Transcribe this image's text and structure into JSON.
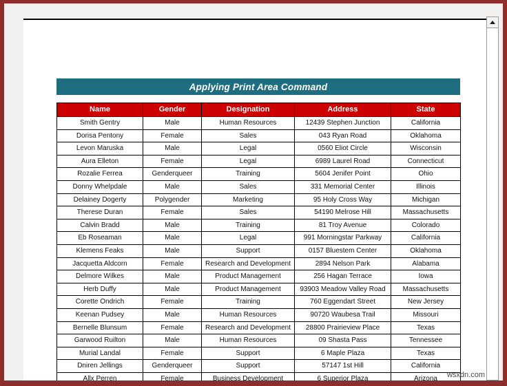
{
  "window": {
    "frame_color": "#8f2c2c",
    "workspace_color": "#f1f0ef",
    "page_color": "#ffffff"
  },
  "banner": {
    "title": "Applying Print Area Command",
    "background": "#1f6e80",
    "text_color": "#ffffff"
  },
  "table": {
    "header_background": "#cc0000",
    "header_text_color": "#ffffff",
    "columns": [
      "Name",
      "Gender",
      "Designation",
      "Address",
      "State"
    ],
    "rows": [
      [
        "Smith Gentry",
        "Male",
        "Human Resources",
        "12439 Stephen Junction",
        "California"
      ],
      [
        "Dorisa Pentony",
        "Female",
        "Sales",
        "043 Ryan Road",
        "Oklahoma"
      ],
      [
        "Levon Maruska",
        "Male",
        "Legal",
        "0560 Eliot Circle",
        "Wisconsin"
      ],
      [
        "Aura Elleton",
        "Female",
        "Legal",
        "6989 Laurel Road",
        "Connecticut"
      ],
      [
        "Rozalie Ferrea",
        "Genderqueer",
        "Training",
        "5604 Jenifer Point",
        "Ohio"
      ],
      [
        "Donny Whelpdale",
        "Male",
        "Sales",
        "331 Memorial Center",
        "Illinois"
      ],
      [
        "Delainey Dogerty",
        "Polygender",
        "Marketing",
        "95 Holy Cross Way",
        "Michigan"
      ],
      [
        "Therese Duran",
        "Female",
        "Sales",
        "54190 Melrose Hill",
        "Massachusetts"
      ],
      [
        "Calvin Bradd",
        "Male",
        "Training",
        "81 Troy Avenue",
        "Colorado"
      ],
      [
        "Eb Roseaman",
        "Male",
        "Legal",
        "991 Morningstar Parkway",
        "California"
      ],
      [
        "Klemens Feaks",
        "Male",
        "Support",
        "0157 Bluestem Center",
        "Oklahoma"
      ],
      [
        "Jacquetta Aldcorn",
        "Female",
        "Research and Development",
        "2894 Nelson Park",
        "Alabama"
      ],
      [
        "Delmore Wilkes",
        "Male",
        "Product Management",
        "256 Hagan Terrace",
        "Iowa"
      ],
      [
        "Herb Duffy",
        "Male",
        "Product Management",
        "93903 Meadow Valley Road",
        "Massachusetts"
      ],
      [
        "Corette Ondrich",
        "Female",
        "Training",
        "760 Eggendart Street",
        "New Jersey"
      ],
      [
        "Keenan Pudsey",
        "Male",
        "Human Resources",
        "90720 Waubesa Trail",
        "Missouri"
      ],
      [
        "Bernelle Blunsum",
        "Female",
        "Research and Development",
        "28800 Prairieview Place",
        "Texas"
      ],
      [
        "Garwood Ruilton",
        "Male",
        "Human Resources",
        "09 Shasta Pass",
        "Tennessee"
      ],
      [
        "Murial Landal",
        "Female",
        "Support",
        "6 Maple Plaza",
        "Texas"
      ],
      [
        "Dniren Jellings",
        "Genderqueer",
        "Support",
        "57147 1st Hill",
        "California"
      ],
      [
        "Allx Perren",
        "Female",
        "Business Development",
        "6 Superior Plaza",
        "Arizona"
      ]
    ]
  },
  "scrollbar": {
    "up_arrow_icon": "triangle-up-icon"
  },
  "watermark": {
    "text": "wsxdn.com"
  }
}
